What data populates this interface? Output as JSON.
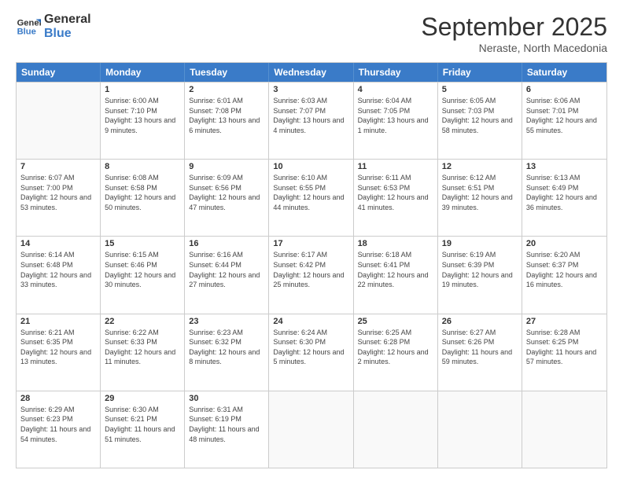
{
  "header": {
    "logo_line1": "General",
    "logo_line2": "Blue",
    "month": "September 2025",
    "location": "Neraste, North Macedonia"
  },
  "days_of_week": [
    "Sunday",
    "Monday",
    "Tuesday",
    "Wednesday",
    "Thursday",
    "Friday",
    "Saturday"
  ],
  "weeks": [
    [
      {
        "day": "",
        "empty": true
      },
      {
        "day": "1",
        "sunrise": "6:00 AM",
        "sunset": "7:10 PM",
        "daylight": "13 hours and 9 minutes."
      },
      {
        "day": "2",
        "sunrise": "6:01 AM",
        "sunset": "7:08 PM",
        "daylight": "13 hours and 6 minutes."
      },
      {
        "day": "3",
        "sunrise": "6:03 AM",
        "sunset": "7:07 PM",
        "daylight": "13 hours and 4 minutes."
      },
      {
        "day": "4",
        "sunrise": "6:04 AM",
        "sunset": "7:05 PM",
        "daylight": "13 hours and 1 minute."
      },
      {
        "day": "5",
        "sunrise": "6:05 AM",
        "sunset": "7:03 PM",
        "daylight": "12 hours and 58 minutes."
      },
      {
        "day": "6",
        "sunrise": "6:06 AM",
        "sunset": "7:01 PM",
        "daylight": "12 hours and 55 minutes."
      }
    ],
    [
      {
        "day": "7",
        "sunrise": "6:07 AM",
        "sunset": "7:00 PM",
        "daylight": "12 hours and 53 minutes."
      },
      {
        "day": "8",
        "sunrise": "6:08 AM",
        "sunset": "6:58 PM",
        "daylight": "12 hours and 50 minutes."
      },
      {
        "day": "9",
        "sunrise": "6:09 AM",
        "sunset": "6:56 PM",
        "daylight": "12 hours and 47 minutes."
      },
      {
        "day": "10",
        "sunrise": "6:10 AM",
        "sunset": "6:55 PM",
        "daylight": "12 hours and 44 minutes."
      },
      {
        "day": "11",
        "sunrise": "6:11 AM",
        "sunset": "6:53 PM",
        "daylight": "12 hours and 41 minutes."
      },
      {
        "day": "12",
        "sunrise": "6:12 AM",
        "sunset": "6:51 PM",
        "daylight": "12 hours and 39 minutes."
      },
      {
        "day": "13",
        "sunrise": "6:13 AM",
        "sunset": "6:49 PM",
        "daylight": "12 hours and 36 minutes."
      }
    ],
    [
      {
        "day": "14",
        "sunrise": "6:14 AM",
        "sunset": "6:48 PM",
        "daylight": "12 hours and 33 minutes."
      },
      {
        "day": "15",
        "sunrise": "6:15 AM",
        "sunset": "6:46 PM",
        "daylight": "12 hours and 30 minutes."
      },
      {
        "day": "16",
        "sunrise": "6:16 AM",
        "sunset": "6:44 PM",
        "daylight": "12 hours and 27 minutes."
      },
      {
        "day": "17",
        "sunrise": "6:17 AM",
        "sunset": "6:42 PM",
        "daylight": "12 hours and 25 minutes."
      },
      {
        "day": "18",
        "sunrise": "6:18 AM",
        "sunset": "6:41 PM",
        "daylight": "12 hours and 22 minutes."
      },
      {
        "day": "19",
        "sunrise": "6:19 AM",
        "sunset": "6:39 PM",
        "daylight": "12 hours and 19 minutes."
      },
      {
        "day": "20",
        "sunrise": "6:20 AM",
        "sunset": "6:37 PM",
        "daylight": "12 hours and 16 minutes."
      }
    ],
    [
      {
        "day": "21",
        "sunrise": "6:21 AM",
        "sunset": "6:35 PM",
        "daylight": "12 hours and 13 minutes."
      },
      {
        "day": "22",
        "sunrise": "6:22 AM",
        "sunset": "6:33 PM",
        "daylight": "12 hours and 11 minutes."
      },
      {
        "day": "23",
        "sunrise": "6:23 AM",
        "sunset": "6:32 PM",
        "daylight": "12 hours and 8 minutes."
      },
      {
        "day": "24",
        "sunrise": "6:24 AM",
        "sunset": "6:30 PM",
        "daylight": "12 hours and 5 minutes."
      },
      {
        "day": "25",
        "sunrise": "6:25 AM",
        "sunset": "6:28 PM",
        "daylight": "12 hours and 2 minutes."
      },
      {
        "day": "26",
        "sunrise": "6:27 AM",
        "sunset": "6:26 PM",
        "daylight": "11 hours and 59 minutes."
      },
      {
        "day": "27",
        "sunrise": "6:28 AM",
        "sunset": "6:25 PM",
        "daylight": "11 hours and 57 minutes."
      }
    ],
    [
      {
        "day": "28",
        "sunrise": "6:29 AM",
        "sunset": "6:23 PM",
        "daylight": "11 hours and 54 minutes."
      },
      {
        "day": "29",
        "sunrise": "6:30 AM",
        "sunset": "6:21 PM",
        "daylight": "11 hours and 51 minutes."
      },
      {
        "day": "30",
        "sunrise": "6:31 AM",
        "sunset": "6:19 PM",
        "daylight": "11 hours and 48 minutes."
      },
      {
        "day": "",
        "empty": true
      },
      {
        "day": "",
        "empty": true
      },
      {
        "day": "",
        "empty": true
      },
      {
        "day": "",
        "empty": true
      }
    ]
  ],
  "labels": {
    "sunrise_prefix": "Sunrise: ",
    "sunset_prefix": "Sunset: ",
    "daylight_prefix": "Daylight: "
  }
}
